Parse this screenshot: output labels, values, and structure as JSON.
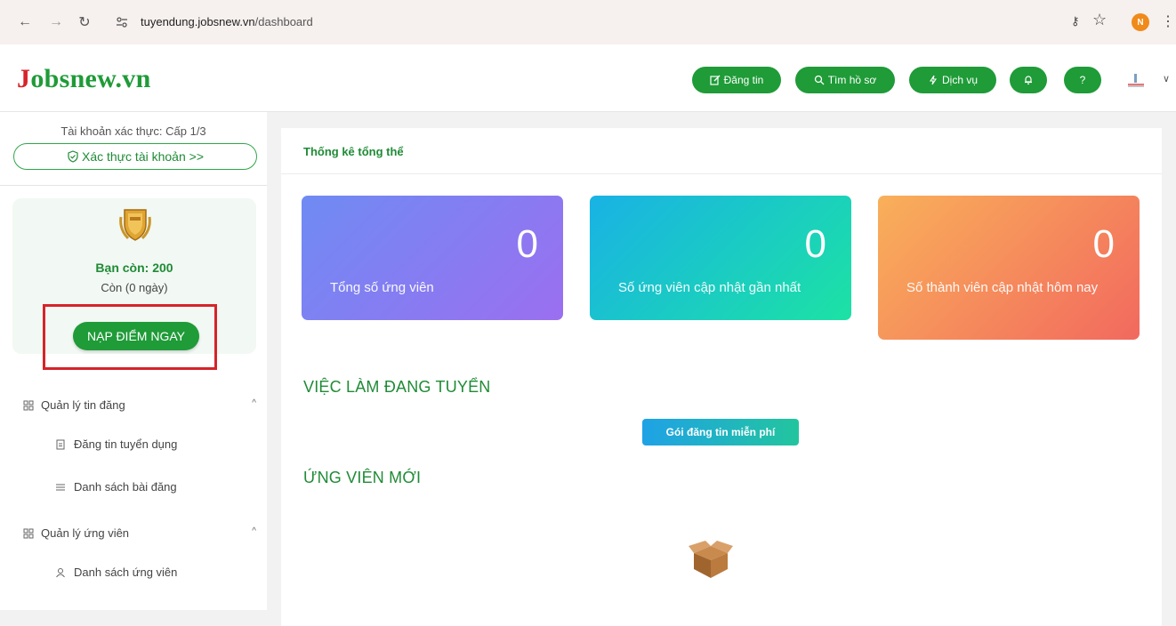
{
  "browser": {
    "url_domain": "tuyendung.jobsnew.vn",
    "url_path": "/dashboard",
    "avatar_letter": "N"
  },
  "header": {
    "logo_first": "J",
    "logo_rest": "obsnew.vn",
    "buttons": {
      "post": "Đăng tin",
      "search": "Tìm hồ sơ",
      "service": "Dịch vụ",
      "help": "?"
    },
    "brand_color": "#1f9b38",
    "logo_accent": "#d6252a"
  },
  "sidebar": {
    "verify_status": "Tài khoản xác thực: Cấp 1/3",
    "verify_button": "Xác thực tài khoản >>",
    "points": "Bạn còn: 200",
    "days": "Còn (0 ngày)",
    "recharge_button": "NẠP ĐIỂM NGAY",
    "menu": [
      {
        "label": "Quản lý tin đăng",
        "items": [
          "Đăng tin tuyển dụng",
          "Danh sách bài đăng"
        ]
      },
      {
        "label": "Quản lý ứng viên",
        "items": [
          "Danh sách ứng viên"
        ]
      }
    ]
  },
  "main": {
    "title": "Thống kê tổng thể",
    "stats": [
      {
        "value": "0",
        "label": "Tổng số ứng viên"
      },
      {
        "value": "0",
        "label": "Số ứng viên cập nhật gần nhất"
      },
      {
        "value": "0",
        "label": "Số thành viên cập nhật hôm nay"
      }
    ],
    "jobs_section": "VIỆC LÀM ĐANG TUYỂN",
    "free_package": "Gói đăng tin miễn phí",
    "candidates_section": "ỨNG VIÊN MỚI"
  }
}
